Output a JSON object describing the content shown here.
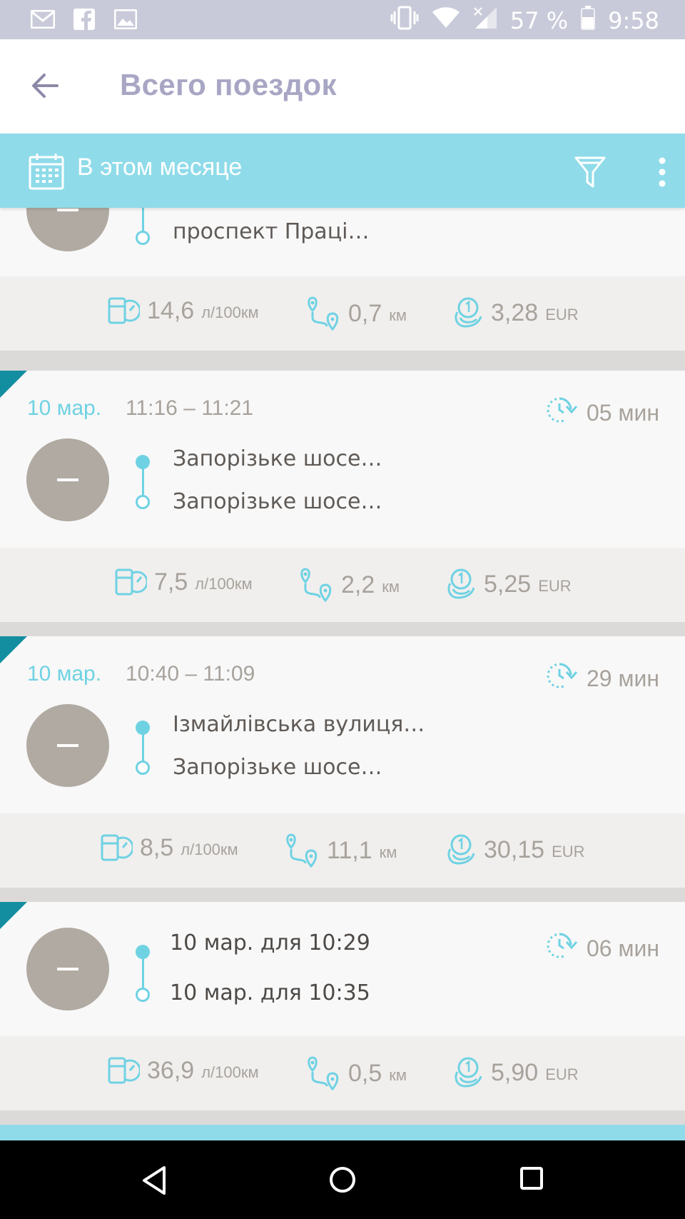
{
  "status_bar": {
    "battery_percent": "57 %",
    "time": "9:58",
    "icons": [
      "gmail-icon",
      "facebook-icon",
      "image-icon",
      "vibrate-icon",
      "wifi-icon",
      "signal-icon",
      "battery-icon"
    ]
  },
  "header": {
    "title": "Всего поездок",
    "back_icon": "arrow-left-icon"
  },
  "filter_bar": {
    "period_label": "В этом месяце",
    "icons": [
      "calendar-icon",
      "filter-icon",
      "more-vert-icon"
    ]
  },
  "trips": [
    {
      "date": "",
      "time_range": "",
      "duration": "",
      "from": "",
      "to": "проспект Праці…",
      "consumption": "14,6",
      "consumption_unit": "л/100км",
      "distance": "0,7",
      "distance_unit": "км",
      "cost": "3,28",
      "cost_unit": "EUR"
    },
    {
      "date": "10 мар.",
      "time_range": "11:16 – 11:21",
      "duration": "05 мин",
      "from": "Запорізьке шосе…",
      "to": "Запорізьке шосе…",
      "consumption": "7,5",
      "consumption_unit": "л/100км",
      "distance": "2,2",
      "distance_unit": "км",
      "cost": "5,25",
      "cost_unit": "EUR"
    },
    {
      "date": "10 мар.",
      "time_range": "10:40 – 11:09",
      "duration": "29 мин",
      "from": "Ізмайлівська вулиця…",
      "to": "Запорізьке шосе…",
      "consumption": "8,5",
      "consumption_unit": "л/100км",
      "distance": "11,1",
      "distance_unit": "км",
      "cost": "30,15",
      "cost_unit": "EUR"
    },
    {
      "date": "",
      "time_range": "",
      "duration": "06 мин",
      "from": "10 мар. для 10:29",
      "to": "10 мар. для 10:35",
      "consumption": "36,9",
      "consumption_unit": "л/100км",
      "distance": "0,5",
      "distance_unit": "км",
      "cost": "5,90",
      "cost_unit": "EUR"
    }
  ],
  "colors": {
    "accent": "#6fd2e3",
    "filter_bar": "#8fdbe9",
    "title": "#a8a6c4",
    "avatar": "#b0aaa2",
    "corner": "#138ea0"
  },
  "nav_bar": {
    "icons": [
      "nav-back-icon",
      "nav-home-icon",
      "nav-recent-icon"
    ]
  }
}
